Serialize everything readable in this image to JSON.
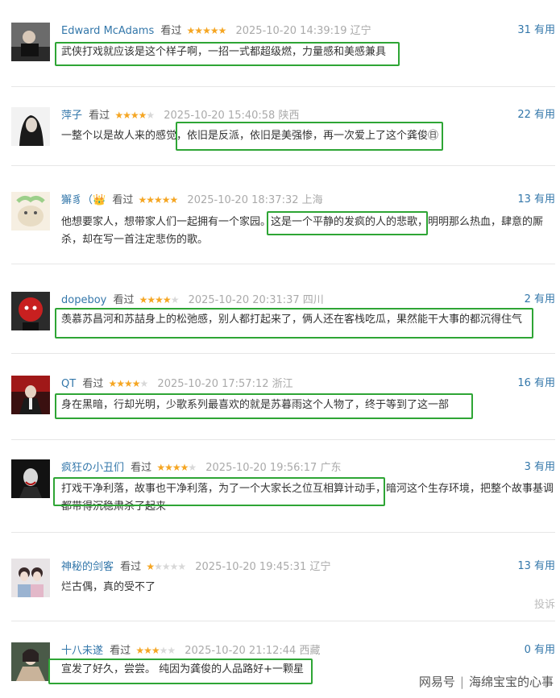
{
  "reviews": [
    {
      "name": "Edward McAdams",
      "label": "看过",
      "stars_on": "★★★★★",
      "stars_off": "",
      "time": "2025-10-20 14:39:19 辽宁",
      "useful": "31 有用",
      "content": "武侠打戏就应该是这个样子啊，一招一式都超级燃，力量感和美感兼具"
    },
    {
      "name": "萍子",
      "label": "看过",
      "stars_on": "★★★★",
      "stars_off": "★",
      "time": "2025-10-20 15:40:58 陕西",
      "useful": "22 有用",
      "content": "一整个以是故人来的感觉，依旧是反派，依旧是美强惨，再一次爱上了这个龚俊㊐"
    },
    {
      "name": "獬豸（👑",
      "label": "看过",
      "stars_on": "★★★★★",
      "stars_off": "",
      "time": "2025-10-20 18:37:32 上海",
      "useful": "13 有用",
      "content": "他想要家人，想带家人们一起拥有一个家园。这是一个平静的发疯的人的悲歌，明明那么热血，肆意的厮杀，却在写一首注定悲伤的歌。"
    },
    {
      "name": "dopeboy",
      "label": "看过",
      "stars_on": "★★★★",
      "stars_off": "★",
      "time": "2025-10-20 20:31:37 四川",
      "useful": "2 有用",
      "content": "羡慕苏昌河和苏喆身上的松弛感，别人都打起来了，俩人还在客栈吃瓜，果然能干大事的都沉得住气"
    },
    {
      "name": "QT",
      "label": "看过",
      "stars_on": "★★★★",
      "stars_off": "★",
      "time": "2025-10-20 17:57:12 浙江",
      "useful": "16 有用",
      "content": "身在黑暗，行却光明，少歌系列最喜欢的就是苏暮雨这个人物了，终于等到了这一部"
    },
    {
      "name": "疯狂の小丑们",
      "label": "看过",
      "stars_on": "★★★★",
      "stars_off": "★",
      "time": "2025-10-20 19:56:17 广东",
      "useful": "3 有用",
      "content": "打戏干净利落，故事也干净利落，为了一个大家长之位互相算计动手，暗河这个生存环境，把整个故事基调都带得沉稳肃杀了起来"
    },
    {
      "name": "神秘的剑客",
      "label": "看过",
      "stars_on": "★",
      "stars_off": "★★★★",
      "time": "2025-10-20 19:45:31 辽宁",
      "useful": "13 有用",
      "content": "烂古偶，真的受不了",
      "report": "投诉"
    },
    {
      "name": "十八未遂",
      "label": "看过",
      "stars_on": "★★★",
      "stars_off": "★★",
      "time": "2025-10-20 21:12:44 西藏",
      "useful": "0 有用",
      "content": "宣发了好久，尝尝。 纯因为龚俊的人品路好+一颗星"
    }
  ],
  "watermark": {
    "site": "网易号",
    "author": "海绵宝宝的心事"
  },
  "colors": {
    "link": "#3377aa",
    "star": "#f5a623",
    "highlight": "#2ea535"
  }
}
